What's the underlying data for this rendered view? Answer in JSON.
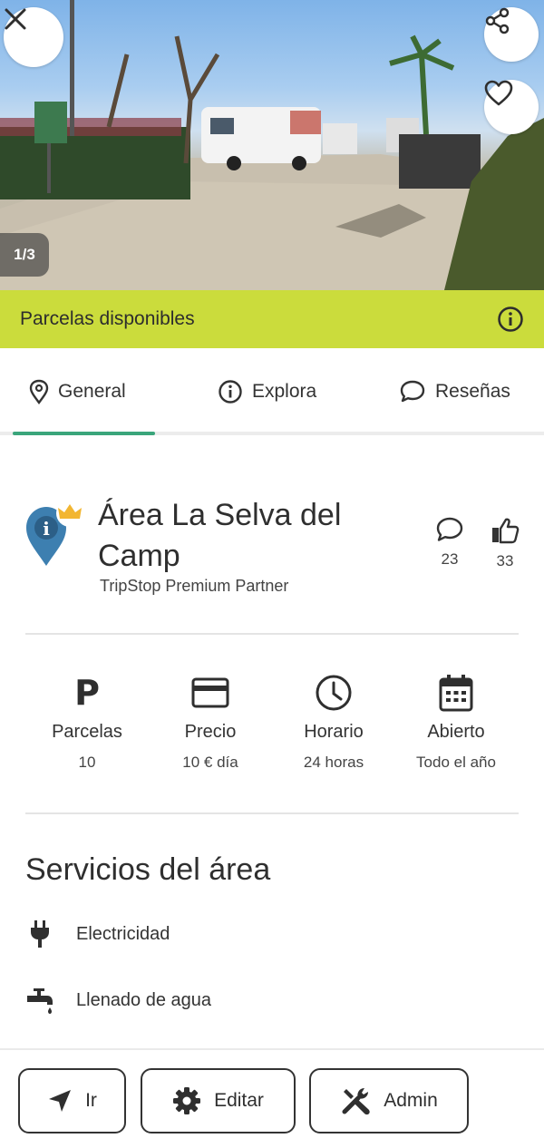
{
  "hero": {
    "photo_counter": "1/3",
    "close_icon": "close-icon",
    "share_icon": "share-icon",
    "favorite_icon": "heart-icon"
  },
  "banner": {
    "text": "Parcelas disponibles",
    "icon": "info-icon",
    "color": "#cbdc3c"
  },
  "tabs": [
    {
      "label": "General",
      "icon": "location-pin-icon",
      "active": true
    },
    {
      "label": "Explora",
      "icon": "info-icon",
      "active": false
    },
    {
      "label": "Reseñas",
      "icon": "chat-bubble-icon",
      "active": false
    }
  ],
  "place": {
    "title": "Área La Selva del Camp",
    "subtitle": "TripStop Premium Partner",
    "comments_count": "23",
    "likes_count": "33"
  },
  "info": [
    {
      "icon": "parking-icon",
      "label": "Parcelas",
      "value": "10"
    },
    {
      "icon": "credit-card-icon",
      "label": "Precio",
      "value": "10 € día"
    },
    {
      "icon": "clock-icon",
      "label": "Horario",
      "value": "24 horas"
    },
    {
      "icon": "calendar-icon",
      "label": "Abierto",
      "value": "Todo el año"
    }
  ],
  "services": {
    "title": "Servicios del área",
    "items": [
      {
        "icon": "plug-icon",
        "label": "Electricidad"
      },
      {
        "icon": "water-tap-icon",
        "label": "Llenado de agua"
      }
    ]
  },
  "actions": {
    "go": "Ir",
    "edit": "Editar",
    "admin": "Admin"
  },
  "colors": {
    "accent_green": "#3aa57b",
    "pin_blue": "#3d7fb0",
    "crown_gold": "#f2b632"
  }
}
